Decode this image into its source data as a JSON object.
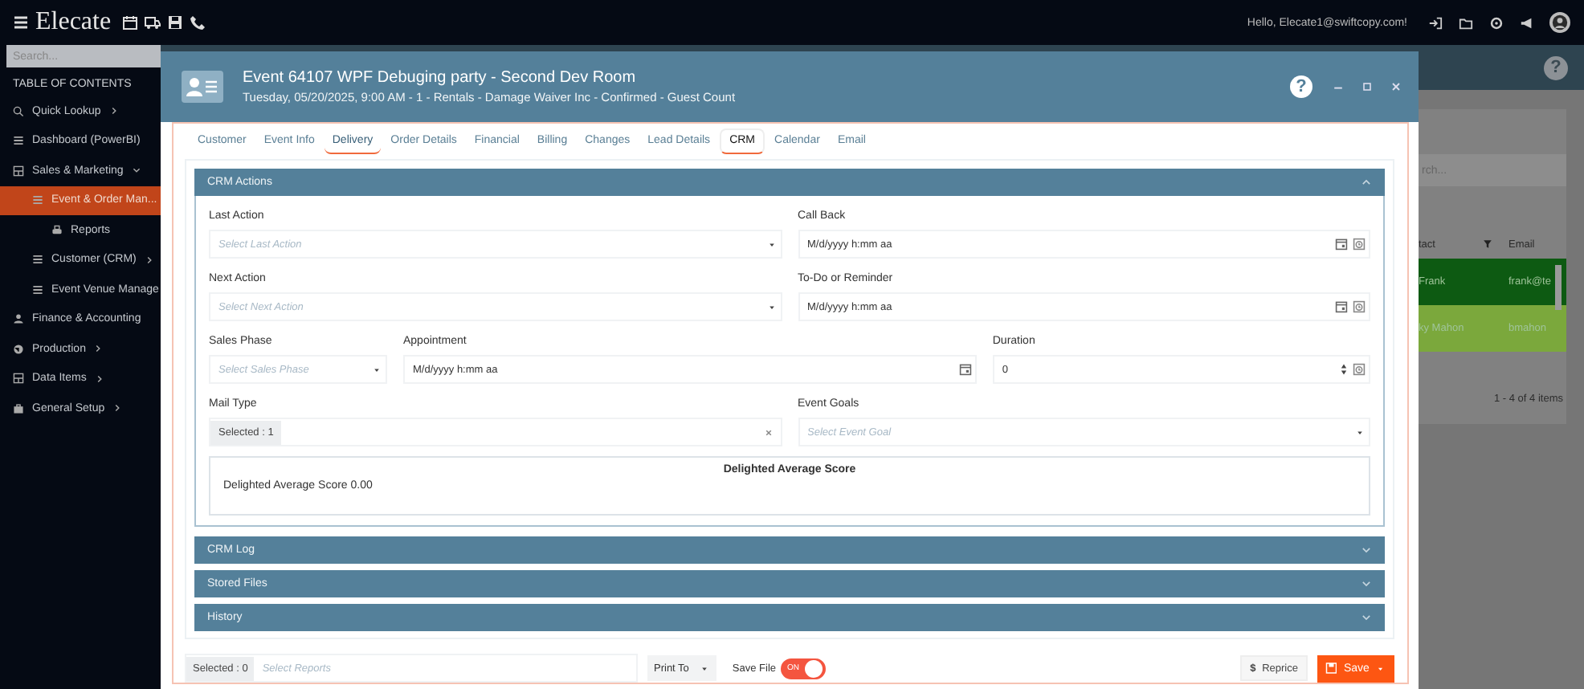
{
  "top_bar": {
    "brand": "Elecate",
    "greeting": "Hello, Elecate1@swiftcopy.com!"
  },
  "sidebar": {
    "search_placeholder": "Search...",
    "heading": "TABLE OF CONTENTS",
    "items": [
      {
        "label": "Quick Lookup",
        "expanded": false,
        "selected": false
      },
      {
        "label": "Dashboard (PowerBI)",
        "selected": false
      },
      {
        "label": "Sales & Marketing",
        "expanded": true,
        "selected": false,
        "children": [
          {
            "label": "Event & Order Man...",
            "selected": true,
            "children": [
              {
                "label": "Reports",
                "selected": false
              }
            ]
          },
          {
            "label": "Customer (CRM)",
            "expanded": false,
            "selected": false
          },
          {
            "label": "Event Venue Manage",
            "selected": false
          }
        ]
      },
      {
        "label": "Finance & Accounting",
        "selected": false
      },
      {
        "label": "Production",
        "expanded": false,
        "selected": false
      },
      {
        "label": "Data Items",
        "expanded": false,
        "selected": false
      },
      {
        "label": "General Setup",
        "expanded": false,
        "selected": false
      }
    ]
  },
  "background": {
    "help_symbol": "?",
    "search_placeholder": "rch...",
    "columns": [
      "tact",
      "Email"
    ],
    "rows": [
      {
        "cells": [
          "Frank",
          "frank@te"
        ],
        "color": "#0d5a12"
      },
      {
        "cells": [
          "ky Mahon",
          "bmahon"
        ],
        "color": "#7ba83c"
      }
    ],
    "pager": "1 - 4 of 4 items"
  },
  "modal": {
    "help_symbol": "?",
    "title": "Event 64107 WPF Debuging party - Second Dev Room",
    "subtitle": "Tuesday, 05/20/2025, 9:00 AM - 1 - Rentals - Damage Waiver Inc - Confirmed - Guest Count",
    "tabs": [
      {
        "label": "Customer",
        "selected": false,
        "underlined": false
      },
      {
        "label": "Event Info",
        "selected": false,
        "underlined": false
      },
      {
        "label": "Delivery",
        "selected": false,
        "underlined": true
      },
      {
        "label": "Order Details",
        "selected": false,
        "underlined": false
      },
      {
        "label": "Financial",
        "selected": false,
        "underlined": false
      },
      {
        "label": "Billing",
        "selected": false,
        "underlined": false
      },
      {
        "label": "Changes",
        "selected": false,
        "underlined": false
      },
      {
        "label": "Lead Details",
        "selected": false,
        "underlined": false
      },
      {
        "label": "CRM",
        "selected": true,
        "underlined": true
      },
      {
        "label": "Calendar",
        "selected": false,
        "underlined": false
      },
      {
        "label": "Email",
        "selected": false,
        "underlined": false
      }
    ],
    "crm_actions": {
      "title": "CRM Actions",
      "expanded": true,
      "rows": [
        {
          "left": {
            "label": "Last Action",
            "kind": "select",
            "placeholder": "Select Last Action"
          },
          "right": [
            {
              "label": "Call Back",
              "kind": "datetime",
              "value": "M/d/yyyy h:mm aa"
            }
          ]
        },
        {
          "left": {
            "label": "Next Action",
            "kind": "select",
            "placeholder": "Select Next Action"
          },
          "right": [
            {
              "label": "To-Do or Reminder",
              "kind": "datetime",
              "value": "M/d/yyyy h:mm aa"
            }
          ]
        },
        {
          "left": {
            "label": "Sales Phase",
            "kind": "select",
            "placeholder": "Select Sales Phase"
          },
          "right": [
            {
              "label": "Appointment",
              "kind": "date",
              "value": "M/d/yyyy h:mm aa"
            },
            {
              "label": "Duration",
              "kind": "number",
              "value": "0"
            }
          ]
        },
        {
          "left": {
            "label": "Mail Type",
            "kind": "multiselect",
            "tag": "Selected : 1"
          },
          "right": [
            {
              "label": "Event Goals",
              "kind": "select",
              "placeholder": "Select Event Goal"
            }
          ]
        }
      ],
      "score": {
        "title": "Delighted Average Score",
        "text": "Delighted Average Score 0.00"
      }
    },
    "sections": [
      {
        "title": "CRM Log",
        "expanded": false
      },
      {
        "title": "Stored Files",
        "expanded": false
      },
      {
        "title": "History",
        "expanded": false
      }
    ],
    "footer": {
      "reports_tag": "Selected : 0",
      "reports_placeholder": "Select Reports",
      "print_label": "Print To",
      "save_file_label": "Save File",
      "save_file_on": true,
      "toggle_text": "ON",
      "reprice_symbol": "$",
      "reprice": "Reprice",
      "save": "Save"
    }
  }
}
